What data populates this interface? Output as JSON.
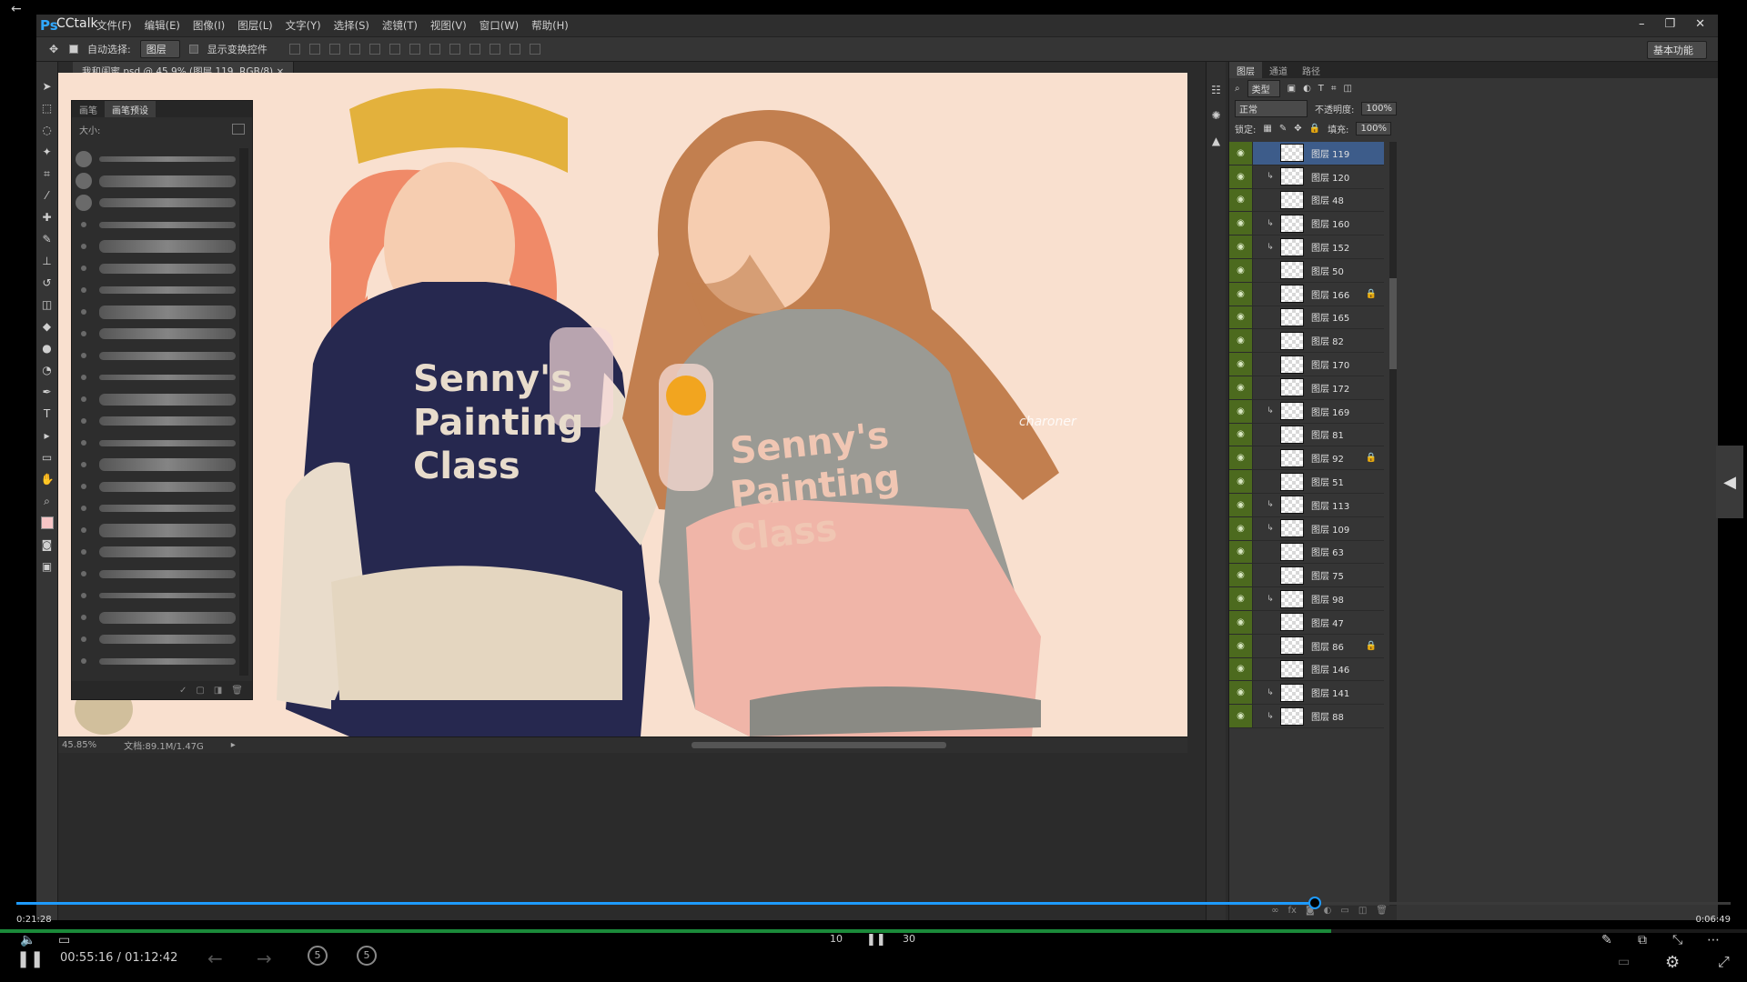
{
  "player": {
    "elapsed_small": "0:21:28",
    "remaining_small": "0:06:49",
    "time_current": "00:55:16",
    "time_total": "01:12:42",
    "time_separator": "/",
    "seek_progress": 0.757,
    "outer_progress": 0.762,
    "rewind_label": "10",
    "forward_label": "30",
    "prev_chapter_label": "5",
    "next_chapter_label": "5"
  },
  "ps": {
    "logo": "Ps",
    "watermark": "CCtalk",
    "menu": [
      "文件(F)",
      "编辑(E)",
      "图像(I)",
      "图层(L)",
      "文字(Y)",
      "选择(S)",
      "滤镜(T)",
      "视图(V)",
      "窗口(W)",
      "帮助(H)"
    ],
    "options": {
      "auto_select_label": "自动选择:",
      "auto_select_value": "图层",
      "show_transform_label": "显示变换控件",
      "workspace": "基本功能"
    },
    "doc_tab": "我和闺蜜.psd @ 45.9% (图层 119, RGB/8)",
    "brush_panel": {
      "tabs": [
        "画笔",
        "画笔预设"
      ],
      "active_tab": 1,
      "size_label": "大小:"
    },
    "status": {
      "zoom": "45.85%",
      "doc_info": "文档:89.1M/1.47G"
    },
    "artist_signature": "charoner",
    "layers_panel": {
      "tabs": [
        "图层",
        "通道",
        "路径"
      ],
      "active_tab": 0,
      "filter_label": "类型",
      "blend_mode": "正常",
      "opacity_label": "不透明度:",
      "opacity_value": "100%",
      "lock_label": "锁定:",
      "fill_label": "填充:",
      "fill_value": "100%",
      "layers": [
        {
          "name": "图层 119",
          "clip": false,
          "selected": true,
          "locked": false
        },
        {
          "name": "图层 120",
          "clip": true,
          "selected": false,
          "locked": false
        },
        {
          "name": "图层 48",
          "clip": false,
          "selected": false,
          "locked": false
        },
        {
          "name": "图层 160",
          "clip": true,
          "selected": false,
          "locked": false
        },
        {
          "name": "图层 152",
          "clip": true,
          "selected": false,
          "locked": false
        },
        {
          "name": "图层 50",
          "clip": false,
          "selected": false,
          "locked": false
        },
        {
          "name": "图层 166",
          "clip": false,
          "selected": false,
          "locked": true
        },
        {
          "name": "图层 165",
          "clip": false,
          "selected": false,
          "locked": false
        },
        {
          "name": "图层 82",
          "clip": false,
          "selected": false,
          "locked": false
        },
        {
          "name": "图层 170",
          "clip": false,
          "selected": false,
          "locked": false
        },
        {
          "name": "图层 172",
          "clip": false,
          "selected": false,
          "locked": false
        },
        {
          "name": "图层 169",
          "clip": true,
          "selected": false,
          "locked": false
        },
        {
          "name": "图层 81",
          "clip": false,
          "selected": false,
          "locked": false
        },
        {
          "name": "图层 92",
          "clip": false,
          "selected": false,
          "locked": true
        },
        {
          "name": "图层 51",
          "clip": false,
          "selected": false,
          "locked": false
        },
        {
          "name": "图层 113",
          "clip": true,
          "selected": false,
          "locked": false
        },
        {
          "name": "图层 109",
          "clip": true,
          "selected": false,
          "locked": false
        },
        {
          "name": "图层 63",
          "clip": false,
          "selected": false,
          "locked": false
        },
        {
          "name": "图层 75",
          "clip": false,
          "selected": false,
          "locked": false
        },
        {
          "name": "图层 98",
          "clip": true,
          "selected": false,
          "locked": false
        },
        {
          "name": "图层 47",
          "clip": false,
          "selected": false,
          "locked": false
        },
        {
          "name": "图层 86",
          "clip": false,
          "selected": false,
          "locked": true
        },
        {
          "name": "图层 146",
          "clip": false,
          "selected": false,
          "locked": false
        },
        {
          "name": "图层 141",
          "clip": true,
          "selected": false,
          "locked": false
        },
        {
          "name": "图层 88",
          "clip": true,
          "selected": false,
          "locked": false
        }
      ]
    },
    "artwork": {
      "sweatshirt_text_left": [
        "Senny's",
        "Painting",
        "Class"
      ],
      "sweatshirt_text_right": [
        "Senny's",
        "Painting",
        "Class"
      ]
    }
  },
  "colors": {
    "accent": "#1e9bff",
    "canvas_bg": "#f9e0cf",
    "eye_col": "#4c6a1e",
    "selected_layer": "#3d5c8a"
  }
}
